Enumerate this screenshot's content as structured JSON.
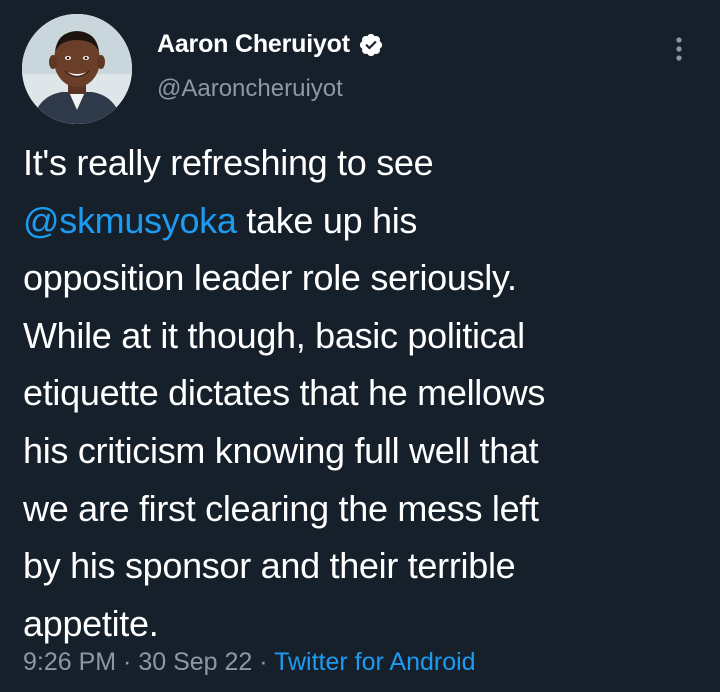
{
  "author": {
    "display_name": "Aaron Cheruiyot",
    "handle": "@Aaroncheruiyot",
    "verified": true
  },
  "tweet": {
    "lines": [
      {
        "segments": [
          {
            "text": "It's really refreshing to see",
            "type": "text"
          }
        ]
      },
      {
        "segments": [
          {
            "text": "@skmusyoka",
            "type": "mention"
          },
          {
            "text": " take up his",
            "type": "text"
          }
        ]
      },
      {
        "segments": [
          {
            "text": "opposition leader role seriously.",
            "type": "text"
          }
        ]
      },
      {
        "segments": [
          {
            "text": "While at it though, basic political",
            "type": "text"
          }
        ]
      },
      {
        "segments": [
          {
            "text": "etiquette dictates that he mellows",
            "type": "text"
          }
        ]
      },
      {
        "segments": [
          {
            "text": "his criticism knowing full well that",
            "type": "text"
          }
        ]
      },
      {
        "segments": [
          {
            "text": "we are first clearing the mess left",
            "type": "text"
          }
        ]
      },
      {
        "segments": [
          {
            "text": "by his sponsor and their terrible",
            "type": "text"
          }
        ]
      },
      {
        "segments": [
          {
            "text": "appetite.",
            "type": "text"
          }
        ]
      }
    ]
  },
  "meta": {
    "time": "9:26 PM",
    "separator": " · ",
    "date": "30 Sep 22",
    "source": "Twitter for Android"
  },
  "icons": {
    "verified": "verified-badge-icon",
    "more": "more-vertical-icon"
  },
  "colors": {
    "background": "#15202b",
    "text": "#ffffff",
    "secondary": "#8b98a5",
    "accent": "#1d9bf0"
  }
}
